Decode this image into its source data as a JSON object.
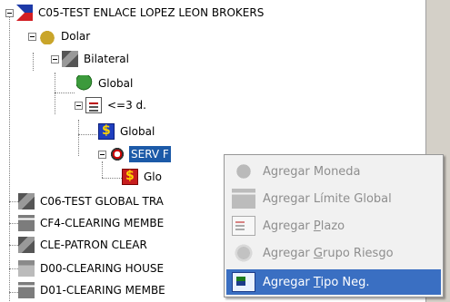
{
  "tree": {
    "root": {
      "label": "C05-TEST ENLACE LOPEZ LEON BROKERS",
      "icon": "flag-icon"
    },
    "dolar": {
      "label": "Dolar",
      "icon": "money-bag-icon"
    },
    "bilateral": {
      "label": "Bilateral",
      "icon": "handshake-money-icon"
    },
    "global1": {
      "label": "Global",
      "icon": "globe-money-icon"
    },
    "plazo": {
      "label": "<=3 d.",
      "icon": "calendar-icon"
    },
    "global2": {
      "label": "Global",
      "icon": "dollar-icon"
    },
    "serv": {
      "label": "SERV F",
      "icon": "target-icon"
    },
    "glo": {
      "label": "Glo",
      "icon": "dollar-red-icon"
    },
    "c06": {
      "label": "C06-TEST GLOBAL TRA",
      "icon": "handshake-icon"
    },
    "cf4": {
      "label": "CF4-CLEARING MEMBE",
      "icon": "bank-icon"
    },
    "cle": {
      "label": "CLE-PATRON CLEAR",
      "icon": "handshake-icon"
    },
    "d00": {
      "label": "D00-CLEARING HOUSE",
      "icon": "house-icon"
    },
    "d01": {
      "label": "D01-CLEARING MEMBE",
      "icon": "bank-icon"
    }
  },
  "context_menu": {
    "items": [
      {
        "label": "Agregar Moneda",
        "enabled": false,
        "icon": "coin-icon"
      },
      {
        "label": "Agregar Límite Global",
        "enabled": false,
        "icon": "bank-icon"
      },
      {
        "label_pre": "Agregar ",
        "label_u": "P",
        "label_post": "lazo",
        "enabled": false,
        "icon": "calendar-icon"
      },
      {
        "label_pre": "Agregar ",
        "label_u": "G",
        "label_post": "rupo Riesgo",
        "enabled": false,
        "icon": "group-icon"
      },
      {
        "label_pre": "Agregar ",
        "label_u": "T",
        "label_post": "ipo Neg.",
        "enabled": true,
        "icon": "type-neg-icon"
      }
    ]
  }
}
